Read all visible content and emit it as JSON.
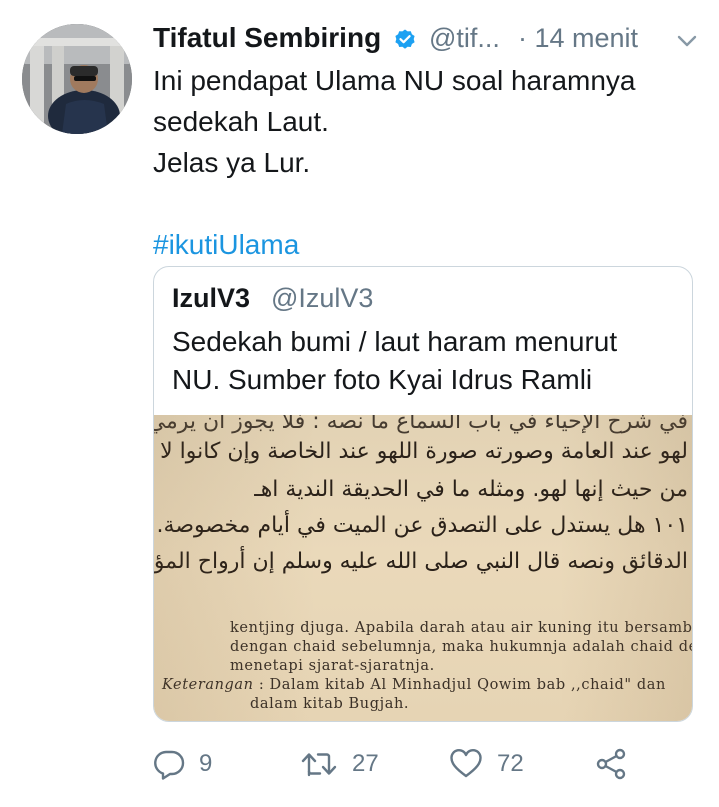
{
  "tweet": {
    "author_name": "Tifatul Sembiring",
    "author_handle": "@tif...",
    "time": "· 14 menit",
    "text_lines": [
      "Ini pendapat Ulama NU soal haramnya",
      "sedekah Laut.",
      "Jelas ya Lur."
    ],
    "hashtag": "#ikutiUlama"
  },
  "quoted_tweet": {
    "author_name": "IzulV3",
    "author_handle": "@IzulV3",
    "text_lines": [
      "Sedekah bumi / laut haram menurut",
      "NU. Sumber foto Kyai Idrus Ramli"
    ],
    "photo_text": {
      "arabic_lines": [
        "في شرح الإحياء في باب السماع ما نصه : فلا يجوز أن يرمي بأخوة تخص على",
        "لهو عند العامة وصورته صورة اللهو عند الخاصة وإن كانوا لا ينظرون إليها",
        "من حيث إنها لهو. ومثله ما في الحديقة الندية اهـ",
        "١٠١ هل يستدل على التصدق عن الميت في أيام مخصوصة. ماوجد في كتاب مطالع",
        "الدقائق ونصه قال النبي صلى الله عليه وسلم إن أرواح المؤمنين يأتون في كل ليلة جمعة أو يوم"
      ],
      "latin_lines": [
        "kentjing djuga. Apabila darah atau air kuning itu bersambung",
        "dengan chaid sebelumnja, maka hukumnja adalah chaid dengan",
        "menetapi sjarat-sjaratnja."
      ],
      "keterangan_label": "Keterangan",
      "keterangan_text": " : Dalam kitab Al Minhadjul Qowim bab ,,chaid\" dan",
      "keterangan_line2": "dalam kitab Bugjah."
    }
  },
  "actions": {
    "reply_count": "9",
    "retweet_count": "27",
    "like_count": "72"
  },
  "colors": {
    "link": "#1b95e0",
    "muted": "#657786",
    "verified": "#1da1f2",
    "border": "#ccd6dd"
  },
  "icons": [
    "verified-badge-icon",
    "chevron-down-icon",
    "reply-icon",
    "retweet-icon",
    "heart-icon",
    "share-icon"
  ]
}
